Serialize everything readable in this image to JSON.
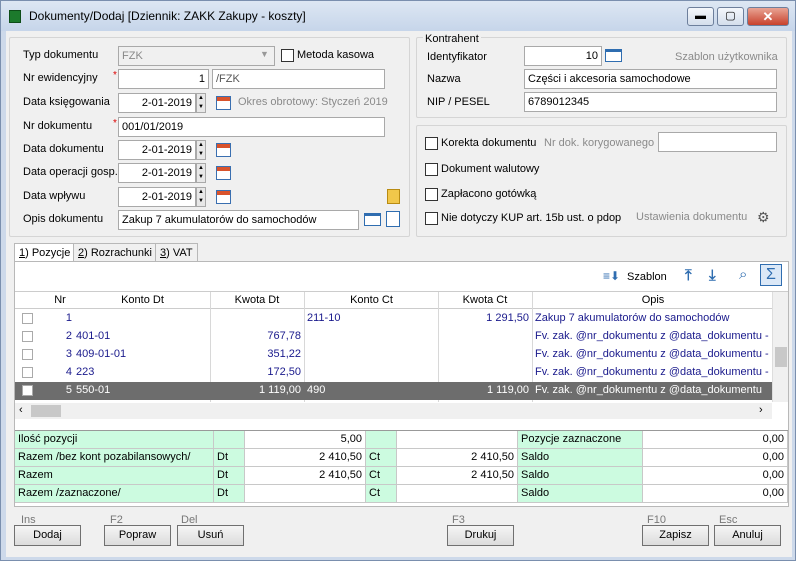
{
  "window": {
    "title": "Dokumenty/Dodaj [Dziennik: ZAKK  Zakupy - koszty]",
    "min": "▬",
    "max": "▢",
    "close": "✕"
  },
  "form": {
    "typ_label": "Typ dokumentu",
    "typ_value": "FZK",
    "metoda_kasowa": "Metoda kasowa",
    "nr_ew_label": "Nr ewidencyjny",
    "nr_ew_value": "1",
    "nr_ew_suffix": "/FZK",
    "data_ksieg_label": "Data księgowania",
    "data_ksieg_value": "2-01-2019",
    "okres": "Okres obrotowy: Styczeń 2019",
    "nr_dok_label": "Nr dokumentu",
    "nr_dok_value": "001/01/2019",
    "data_dok_label": "Data dokumentu",
    "data_dok_value": "2-01-2019",
    "data_op_label": "Data operacji gosp.",
    "data_op_value": "2-01-2019",
    "data_wpl_label": "Data wpływu",
    "data_wpl_value": "2-01-2019",
    "opis_label": "Opis dokumentu",
    "opis_value": "Zakup 7 akumulatorów do samochodów"
  },
  "kontrahent": {
    "title": "Kontrahent",
    "id_label": "Identyfikator",
    "id_value": "10",
    "szablon": "Szablon użytkownika",
    "nazwa_label": "Nazwa",
    "nazwa_value": "Części i akcesoria samochodowe",
    "nip_label": "NIP / PESEL",
    "nip_value": "6789012345"
  },
  "options": {
    "korekta": "Korekta dokumentu",
    "nr_kor_label": "Nr dok. korygowanego",
    "walutowy": "Dokument walutowy",
    "gotowka": "Zapłacono gotówką",
    "kup": "Nie dotyczy KUP art. 15b ust. o pdop",
    "ustawienia": "Ustawienia dokumentu"
  },
  "tabs": [
    {
      "key": "1",
      "label": ") Pozycje"
    },
    {
      "key": "2",
      "label": ") Rozrachunki"
    },
    {
      "key": "3",
      "label": ") VAT"
    }
  ],
  "toolbar": {
    "szablon": "Szablon"
  },
  "grid": {
    "headers": {
      "nr": "Nr",
      "konto_dt": "Konto Dt",
      "kwota_dt": "Kwota Dt",
      "konto_ct": "Konto Ct",
      "kwota_ct": "Kwota Ct",
      "opis": "Opis"
    },
    "rows": [
      {
        "nr": "1",
        "konto_dt": "",
        "kwota_dt": "",
        "konto_ct": "211-10",
        "kwota_ct": "1 291,50",
        "opis": "Zakup 7 akumulatorów do samochodów"
      },
      {
        "nr": "2",
        "konto_dt": "401-01",
        "kwota_dt": "767,78",
        "konto_ct": "",
        "kwota_ct": "",
        "opis": "Fv. zak. @nr_dokumentu z @data_dokumentu - M"
      },
      {
        "nr": "3",
        "konto_dt": "409-01-01",
        "kwota_dt": "351,22",
        "konto_ct": "",
        "kwota_ct": "",
        "opis": "Fv. zak. @nr_dokumentu z @data_dokumentu - M"
      },
      {
        "nr": "4",
        "konto_dt": "223",
        "kwota_dt": "172,50",
        "konto_ct": "",
        "kwota_ct": "",
        "opis": "Fv. zak. @nr_dokumentu z @data_dokumentu - V"
      },
      {
        "nr": "5",
        "konto_dt": "550-01",
        "kwota_dt": "1 119,00",
        "konto_ct": "490",
        "kwota_ct": "1 119,00",
        "opis": "Fv. zak. @nr_dokumentu z @data_dokumentu"
      }
    ]
  },
  "summary": [
    {
      "label": "Ilość pozycji",
      "dt": "",
      "dt_val": "5,00",
      "ct": "",
      "ct_val": "",
      "r_label": "Pozycje zaznaczone",
      "r_val": "0,00"
    },
    {
      "label": "Razem /bez kont pozabilansowych/",
      "dt": "Dt",
      "dt_val": "2 410,50",
      "ct": "Ct",
      "ct_val": "2 410,50",
      "r_label": "Saldo",
      "r_val": "0,00"
    },
    {
      "label": "Razem",
      "dt": "Dt",
      "dt_val": "2 410,50",
      "ct": "Ct",
      "ct_val": "2 410,50",
      "r_label": "Saldo",
      "r_val": "0,00"
    },
    {
      "label": "Razem /zaznaczone/",
      "dt": "Dt",
      "dt_val": "",
      "ct": "Ct",
      "ct_val": "",
      "r_label": "Saldo",
      "r_val": "0,00"
    }
  ],
  "buttons": {
    "dodaj_key": "Ins",
    "dodaj": "Dodaj",
    "popraw_key": "F2",
    "popraw": "Popraw",
    "usun_key": "Del",
    "usun": "Usuń",
    "drukuj_key": "F3",
    "drukuj": "Drukuj",
    "zapisz_key": "F10",
    "zapisz": "Zapisz",
    "anuluj_key": "Esc",
    "anuluj": "Anuluj"
  }
}
